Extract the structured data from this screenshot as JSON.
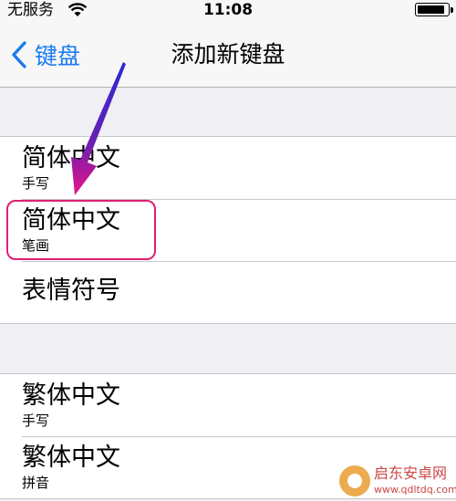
{
  "status_bar": {
    "carrier": "无服务",
    "time": "11:08",
    "battery_level": 0.95
  },
  "nav": {
    "back_label": "键盘",
    "title": "添加新键盘"
  },
  "groups": [
    {
      "cells": [
        {
          "title": "简体中文",
          "subtitle": "手写"
        },
        {
          "title": "简体中文",
          "subtitle": "笔画"
        },
        {
          "title": "表情符号",
          "subtitle": ""
        }
      ]
    },
    {
      "cells": [
        {
          "title": "繁体中文",
          "subtitle": "手写"
        },
        {
          "title": "繁体中文",
          "subtitle": "拼音"
        }
      ]
    }
  ],
  "watermark": {
    "text": "启东安卓网",
    "url": "www.qdltdq.com"
  },
  "colors": {
    "accent": "#1a7bf2",
    "highlight": "#e01f73"
  }
}
